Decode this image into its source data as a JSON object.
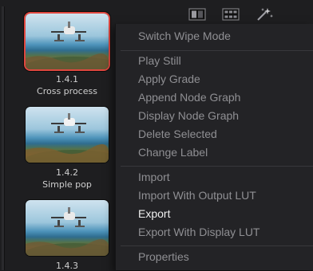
{
  "toolbar": {
    "icons": [
      "split-screen-icon",
      "grid-view-icon",
      "magic-wand-icon"
    ]
  },
  "stills": [
    {
      "number": "1.4.1",
      "label": "Cross process",
      "selected": true
    },
    {
      "number": "1.4.2",
      "label": "Simple pop",
      "selected": false
    },
    {
      "number": "1.4.3",
      "label": "",
      "selected": false
    }
  ],
  "context_menu": {
    "groups": [
      [
        "Switch Wipe Mode"
      ],
      [
        "Play Still",
        "Apply Grade",
        "Append Node Graph",
        "Display Node Graph",
        "Delete Selected",
        "Change Label"
      ],
      [
        "Import",
        "Import With Output LUT",
        "Export",
        "Export With Display LUT"
      ],
      [
        "Properties"
      ]
    ],
    "active_item": "Export"
  },
  "colors": {
    "selection_border": "#e0473f",
    "menu_background": "#232326",
    "menu_text": "#8f8f93",
    "menu_text_active": "#f0f0f0"
  }
}
